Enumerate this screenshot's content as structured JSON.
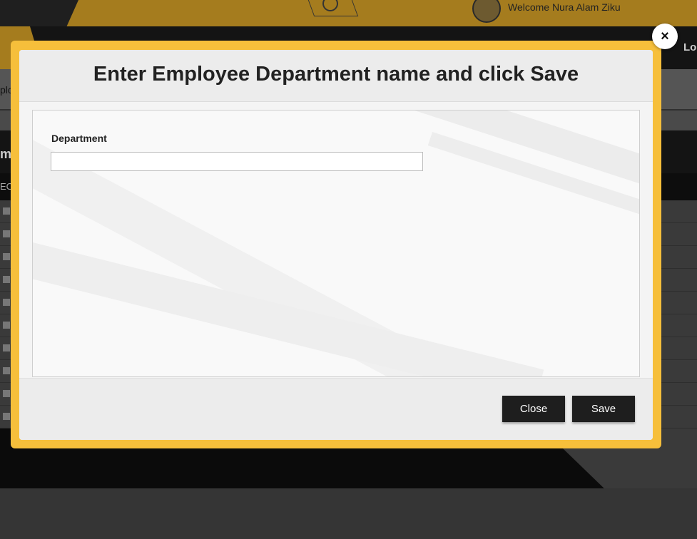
{
  "background": {
    "welcome_text": "Welcome Nura Alam Ziku",
    "logout_partial": "Lo",
    "toolbar_partial": "plc",
    "section_partial": "m",
    "table_head_partial": "EC"
  },
  "modal": {
    "title": "Enter Employee Department name and click Save",
    "department_label": "Department",
    "department_value": "",
    "close_label": "Close",
    "save_label": "Save",
    "dismiss_symbol": "×"
  },
  "colors": {
    "frame": "#f6bf3b",
    "button": "#1e1e1e",
    "topbar": "#a57c1e"
  }
}
